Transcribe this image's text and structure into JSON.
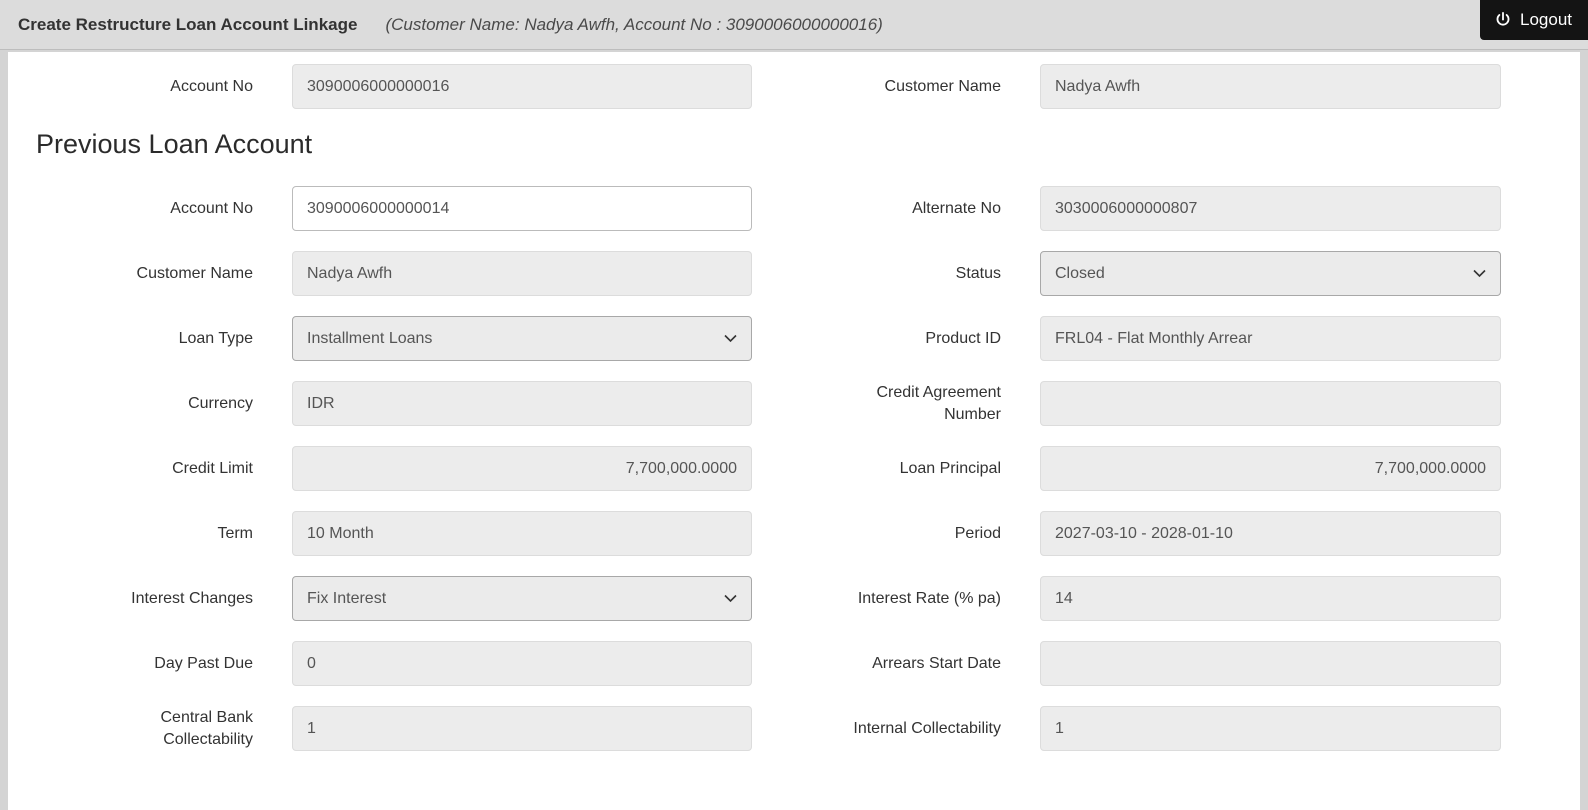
{
  "header": {
    "title": "Create Restructure Loan Account Linkage",
    "subtitle": "(Customer Name: Nadya Awfh, Account No : 3090006000000016)",
    "logout_label": "Logout"
  },
  "summary": {
    "account_no": {
      "label": "Account No",
      "value": "3090006000000016"
    },
    "customer_name": {
      "label": "Customer Name",
      "value": "Nadya Awfh"
    }
  },
  "previous_loan": {
    "section_title": "Previous Loan Account",
    "account_no": {
      "label": "Account No",
      "value": "3090006000000014"
    },
    "alternate_no": {
      "label": "Alternate No",
      "value": "3030006000000807"
    },
    "customer_name": {
      "label": "Customer Name",
      "value": "Nadya Awfh"
    },
    "status": {
      "label": "Status",
      "value": "Closed"
    },
    "loan_type": {
      "label": "Loan Type",
      "value": "Installment Loans"
    },
    "product_id": {
      "label": "Product ID",
      "value": "FRL04 - Flat Monthly Arrear"
    },
    "currency": {
      "label": "Currency",
      "value": "IDR"
    },
    "credit_agreement_number": {
      "label": "Credit Agreement Number",
      "value": ""
    },
    "credit_limit": {
      "label": "Credit Limit",
      "value": "7,700,000.0000"
    },
    "loan_principal": {
      "label": "Loan Principal",
      "value": "7,700,000.0000"
    },
    "term": {
      "label": "Term",
      "value": "10 Month"
    },
    "period": {
      "label": "Period",
      "value": "2027-03-10 - 2028-01-10"
    },
    "interest_changes": {
      "label": "Interest Changes",
      "value": "Fix Interest"
    },
    "interest_rate": {
      "label": "Interest Rate (% pa)",
      "value": "14"
    },
    "day_past_due": {
      "label": "Day Past Due",
      "value": "0"
    },
    "arrears_start_date": {
      "label": "Arrears Start Date",
      "value": ""
    },
    "central_bank_collectability": {
      "label": "Central Bank Collectability",
      "value": "1"
    },
    "internal_collectability": {
      "label": "Internal Collectability",
      "value": "1"
    }
  }
}
